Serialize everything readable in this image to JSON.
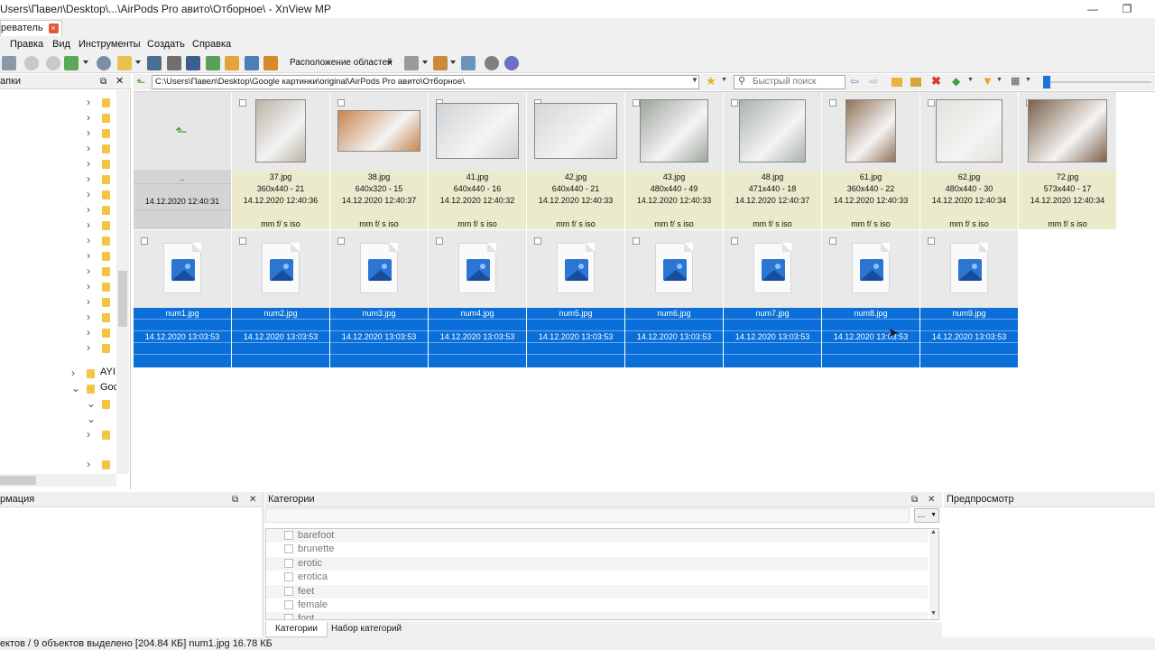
{
  "window": {
    "title": "Users\\Павел\\Desktop\\...\\AirPods Pro авито\\Отборное\\ - XnView MP",
    "minimize": "—",
    "restore": "❐"
  },
  "tabs": [
    {
      "label": "реватель"
    }
  ],
  "menu": [
    "Правка",
    "Вид",
    "Инструменты",
    "Создать",
    "Справка"
  ],
  "toolbar": {
    "areas_label": "Расположение областей"
  },
  "tree": {
    "header": "апки",
    "labels": {
      "ayi": "AYI",
      "goo": "Goo"
    }
  },
  "address": {
    "path": "C:\\Users\\Павел\\Desktop\\Google картинки\\original\\AirPods Pro авито\\Отборное\\",
    "search_placeholder": "Быстрый поиск"
  },
  "browser": {
    "parent": {
      "name": "..",
      "date": "14.12.2020 12:40:31"
    },
    "photos": [
      {
        "name": "37.jpg",
        "dims": "360x440 - 21",
        "date": "14.12.2020 12:40:36",
        "exif": "mm f/ s iso",
        "tone": "#b9b2a6"
      },
      {
        "name": "38.jpg",
        "dims": "640x320 - 15",
        "date": "14.12.2020 12:40:37",
        "exif": "mm f/ s iso",
        "tone": "#c8854e"
      },
      {
        "name": "41.jpg",
        "dims": "640x440 - 16",
        "date": "14.12.2020 12:40:32",
        "exif": "mm f/ s iso",
        "tone": "#cfd3d6"
      },
      {
        "name": "42.jpg",
        "dims": "640x440 - 21",
        "date": "14.12.2020 12:40:33",
        "exif": "mm f/ s iso",
        "tone": "#d6d6d6"
      },
      {
        "name": "43.jpg",
        "dims": "480x440 - 49",
        "date": "14.12.2020 12:40:33",
        "exif": "mm f/ s iso",
        "tone": "#9ea59c"
      },
      {
        "name": "48.jpg",
        "dims": "471x440 - 18",
        "date": "14.12.2020 12:40:37",
        "exif": "mm f/ s iso",
        "tone": "#aab2b0"
      },
      {
        "name": "61.jpg",
        "dims": "360x440 - 22",
        "date": "14.12.2020 12:40:33",
        "exif": "mm f/ s iso",
        "tone": "#8f7356"
      },
      {
        "name": "62.jpg",
        "dims": "480x440 - 30",
        "date": "14.12.2020 12:40:34",
        "exif": "mm f/ s iso",
        "tone": "#e3e1da"
      },
      {
        "name": "72.jpg",
        "dims": "573x440 - 17",
        "date": "14.12.2020 12:40:34",
        "exif": "mm f/ s iso",
        "tone": "#7d6048"
      }
    ],
    "selected": [
      {
        "name": "num1.jpg",
        "date": "14.12.2020 13:03:53"
      },
      {
        "name": "num2.jpg",
        "date": "14.12.2020 13:03:53"
      },
      {
        "name": "num3.jpg",
        "date": "14.12.2020 13:03:53"
      },
      {
        "name": "num4.jpg",
        "date": "14.12.2020 13:03:53"
      },
      {
        "name": "num5.jpg",
        "date": "14.12.2020 13:03:53"
      },
      {
        "name": "num6.jpg",
        "date": "14.12.2020 13:03:53"
      },
      {
        "name": "num7.jpg",
        "date": "14.12.2020 13:03:53"
      },
      {
        "name": "num8.jpg",
        "date": "14.12.2020 13:03:53"
      },
      {
        "name": "num9.jpg",
        "date": "14.12.2020 13:03:53"
      }
    ]
  },
  "panels": {
    "info_title": "рмация",
    "categories_title": "Категории",
    "preview_title": "Предпросмотр",
    "categories": [
      "barefoot",
      "brunette",
      "erotic",
      "erotica",
      "feet",
      "female",
      "foot"
    ],
    "dots_button": "...",
    "tab_categories": "Категории",
    "tab_category_sets": "Набор категорий"
  },
  "status": "ектов / 9 объектов выделено [204.84 КБ]  num1.jpg  16.78 КБ",
  "colors": {
    "selection": "#0a6fd8",
    "info_bg": "#ebeacc",
    "folder": "#f4c542"
  }
}
